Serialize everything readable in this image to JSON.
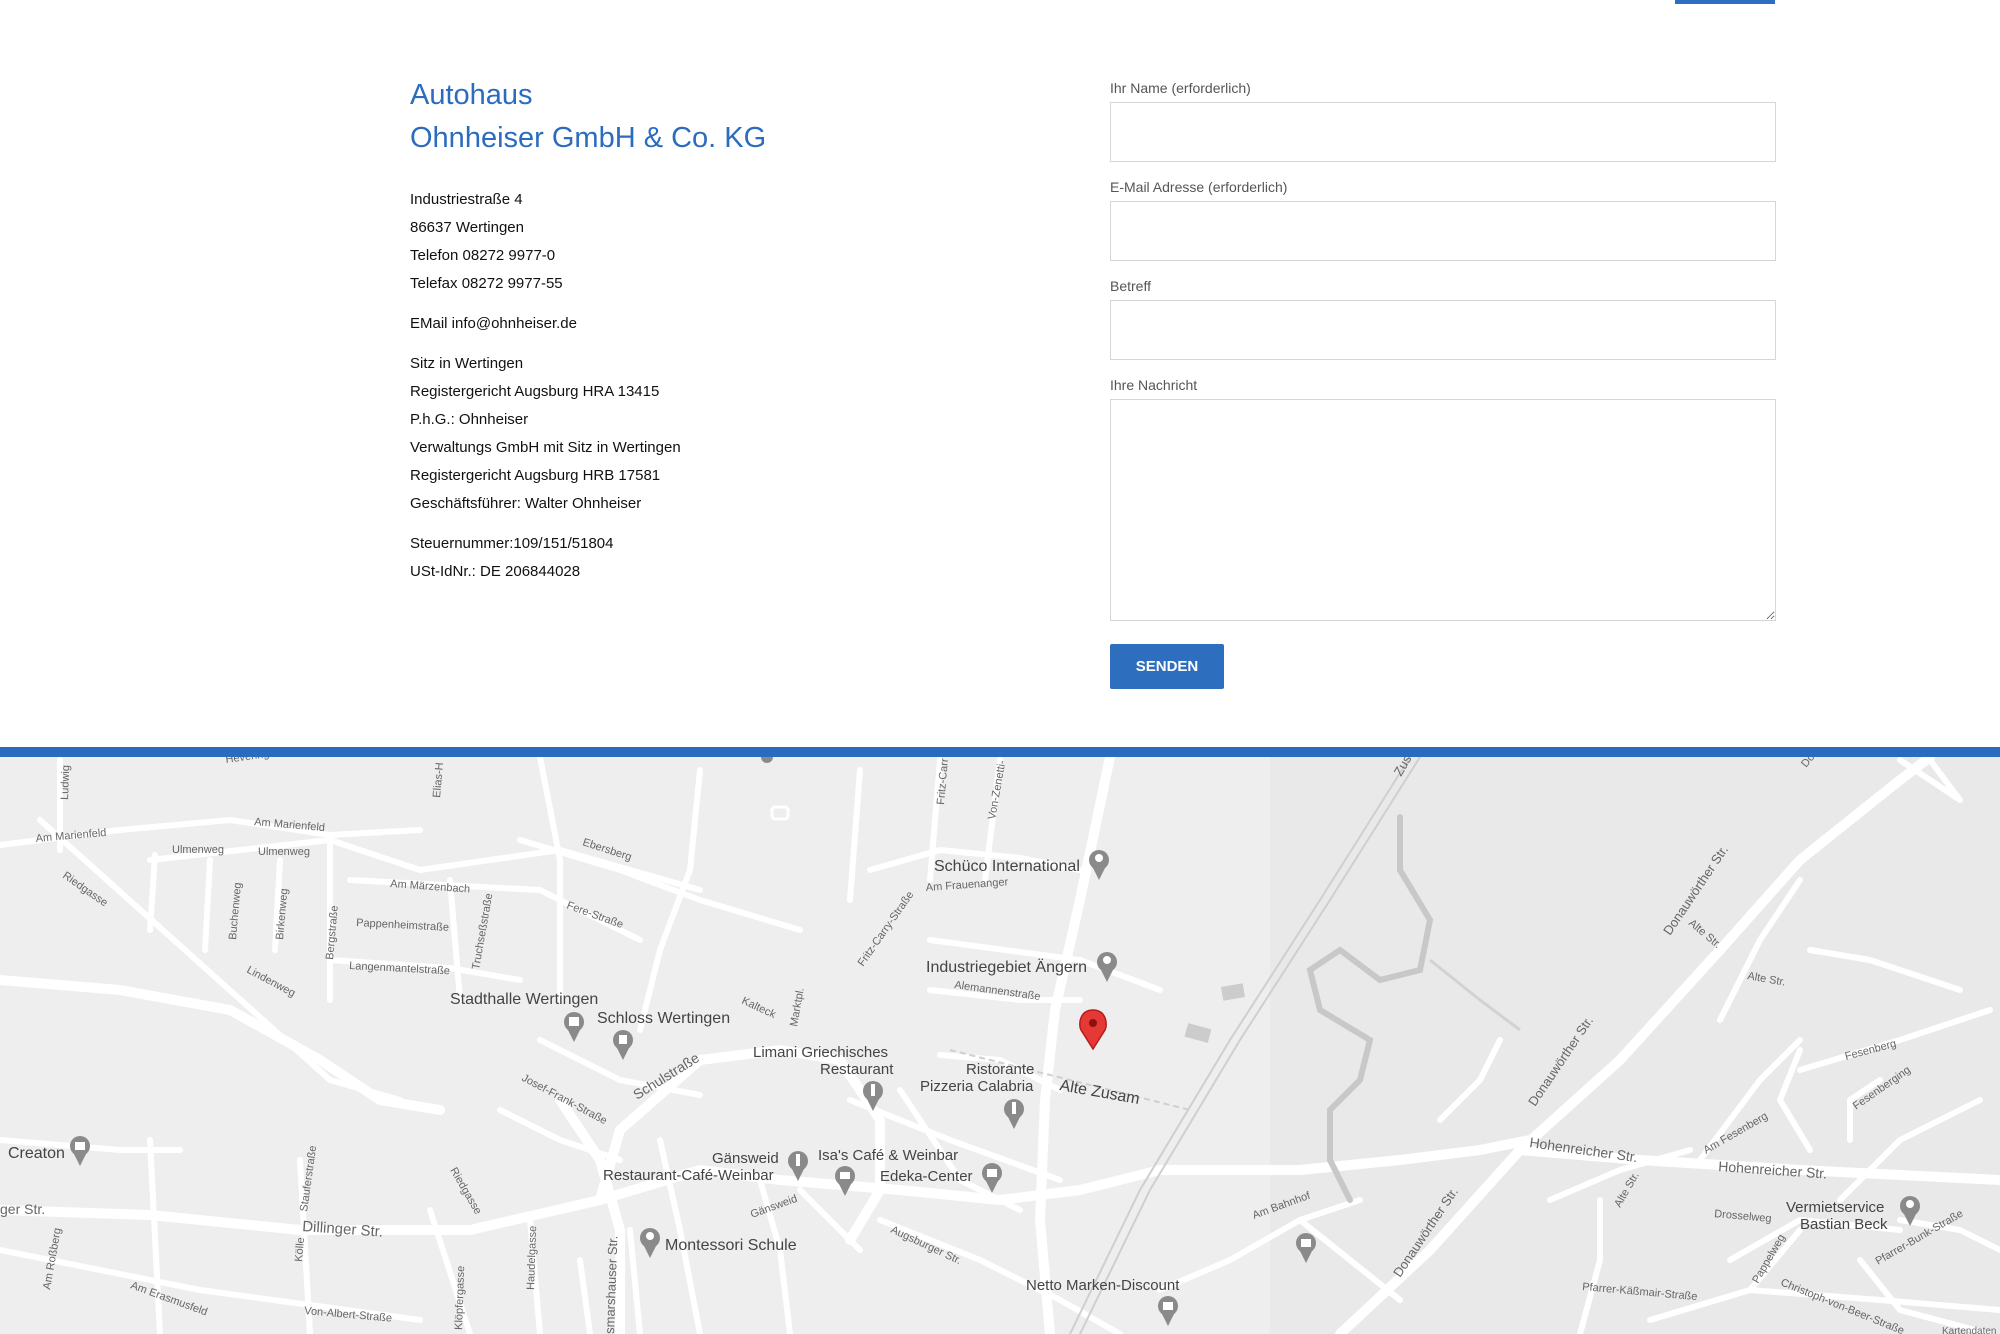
{
  "company": {
    "title_line1": "Autohaus",
    "title_line2": "Ohnheiser GmbH & Co. KG",
    "address_lines": [
      "Industriestraße 4",
      "86637 Wertingen",
      "Telefon 08272 9977-0",
      "Telefax 08272 9977-55"
    ],
    "email_line": "EMail info@ohnheiser.de",
    "registration_lines": [
      "Sitz in Wertingen",
      "Registergericht Augsburg HRA 13415",
      "P.h.G.: Ohnheiser",
      "Verwaltungs GmbH mit Sitz in Wertingen",
      "Registergericht Augsburg HRB 17581",
      "Geschäftsführer: Walter Ohnheiser"
    ],
    "tax_lines": [
      "Steuernummer:109/151/51804",
      "USt-IdNr.: DE 206844028"
    ]
  },
  "form": {
    "name_label": "Ihr Name (erforderlich)",
    "email_label": "E-Mail Adresse (erforderlich)",
    "subject_label": "Betreff",
    "message_label": "Ihre Nachricht",
    "submit_label": "SENDEN"
  },
  "map": {
    "places": {
      "schueco": "Schüco International",
      "industriegebiet": "Industriegebiet Ängern",
      "stadthalle": "Stadthalle Wertingen",
      "schloss": "Schloss Wertingen",
      "limani_line1": "Limani Griechisches",
      "limani_line2": "Restaurant",
      "calabria_line1": "Ristorante",
      "calabria_line2": "Pizzeria Calabria",
      "creaton": "Creaton",
      "gaensweid_line1": "Gänsweid",
      "gaensweid_line2": "Restaurant-Café-Weinbar",
      "isas": "Isa's Café & Weinbar",
      "edeka": "Edeka-Center",
      "montessori": "Montessori Schule",
      "netto": "Netto Marken-Discount",
      "vermiet_line1": "Vermietservice",
      "vermiet_line2": "Bastian Beck",
      "alte_zusam": "Alte Zusam"
    },
    "streets": {
      "ludwig": "Ludwig",
      "am_marienfeld": "Am Marienfeld",
      "am_marienfeld_2": "Am Marienfeld",
      "ulmenweg": "Ulmenweg",
      "ulmenweg_2": "Ulmenweg",
      "riedgasse": "Riedgasse",
      "ebersberg": "Ebersberg",
      "am_maerzenbach": "Am Märzenbach",
      "fere_strasse": "Fere-Straße",
      "pappenheimstrasse": "Pappenheimstraße",
      "langenmantelstrasse": "Langenmantelstraße",
      "lindenweg": "Lindenweg",
      "buchenweg": "Buchenweg",
      "birkenweg": "Birkenweg",
      "bergstrasse": "Bergstraße",
      "truchsessstrasse": "Truchseßstraße",
      "am_frauenanger": "Am Frauenanger",
      "alemannenstrasse": "Alemannenstraße",
      "fritz_carry": "Fritz-Carry-Straße",
      "kalteck": "Kalteck",
      "marktpl": "Marktpl.",
      "schulstrasse": "Schulstraße",
      "josef_frank": "Josef-Frank-Straße",
      "dillinger_str": "Dillinger Str.",
      "ger_str": "ger Str.",
      "staufer": "Stauferstraße",
      "koelle": "Kölle",
      "riedgasse_2": "Riedgasse",
      "am_rossberg": "Am Roßberg",
      "am_erasmusfeld": "Am Erasmusfeld",
      "von_albert": "Von-Albert-Straße",
      "kloepfergasse": "Klöpfergasse",
      "haudelgasse": "Haudelgasse",
      "smarshauser": "smarshauser Str.",
      "gaensweid_str": "Gänsweid",
      "augsburger_str": "Augsburger Str.",
      "am_bahnhof": "Am Bahnhof",
      "donauwoerther_1": "Donauwörther Str.",
      "donauwoerther_2": "Donauwörther Str.",
      "donauwoerther_3": "Donauwörther Str.",
      "hohenreicher_1": "Hohenreicher Str.",
      "hohenreicher_2": "Hohenreicher Str.",
      "alte_str_1": "Alte Str.",
      "alte_str_2": "Alte Str.",
      "alte_str_3": "Alte Str.",
      "fesenberg": "Fesenberg",
      "fesenberging": "Fesenberging",
      "am_fesenberg": "Am Fesenberg",
      "drosselweg": "Drosselweg",
      "pfarrer_bunk": "Pfarrer-Bunk-Straße",
      "pfarrer_kaessmair": "Pfarrer-Käßmair-Straße",
      "pappelweg": "Pappelweg",
      "christoph": "Christoph-von-Beer-Straße",
      "zus": "Zus",
      "do": "Do",
      "hevering": "Hevering",
      "elias": "Elias-H",
      "fritz_carr": "Fritz-Carr",
      "von_zenetti": "Von-Zenetti-",
      "kartendaten": "Kartendaten"
    }
  },
  "colors": {
    "accent_blue": "#2b6cbf",
    "map_background": "#eeeeee",
    "road": "#ffffff",
    "marker_red": "#e53935",
    "poi_grey": "#888888"
  },
  "icons": [
    "map-pin-icon",
    "restaurant-icon",
    "cafe-icon",
    "shopping-icon",
    "museum-icon",
    "landmark-icon",
    "school-icon",
    "location-marker-icon"
  ]
}
